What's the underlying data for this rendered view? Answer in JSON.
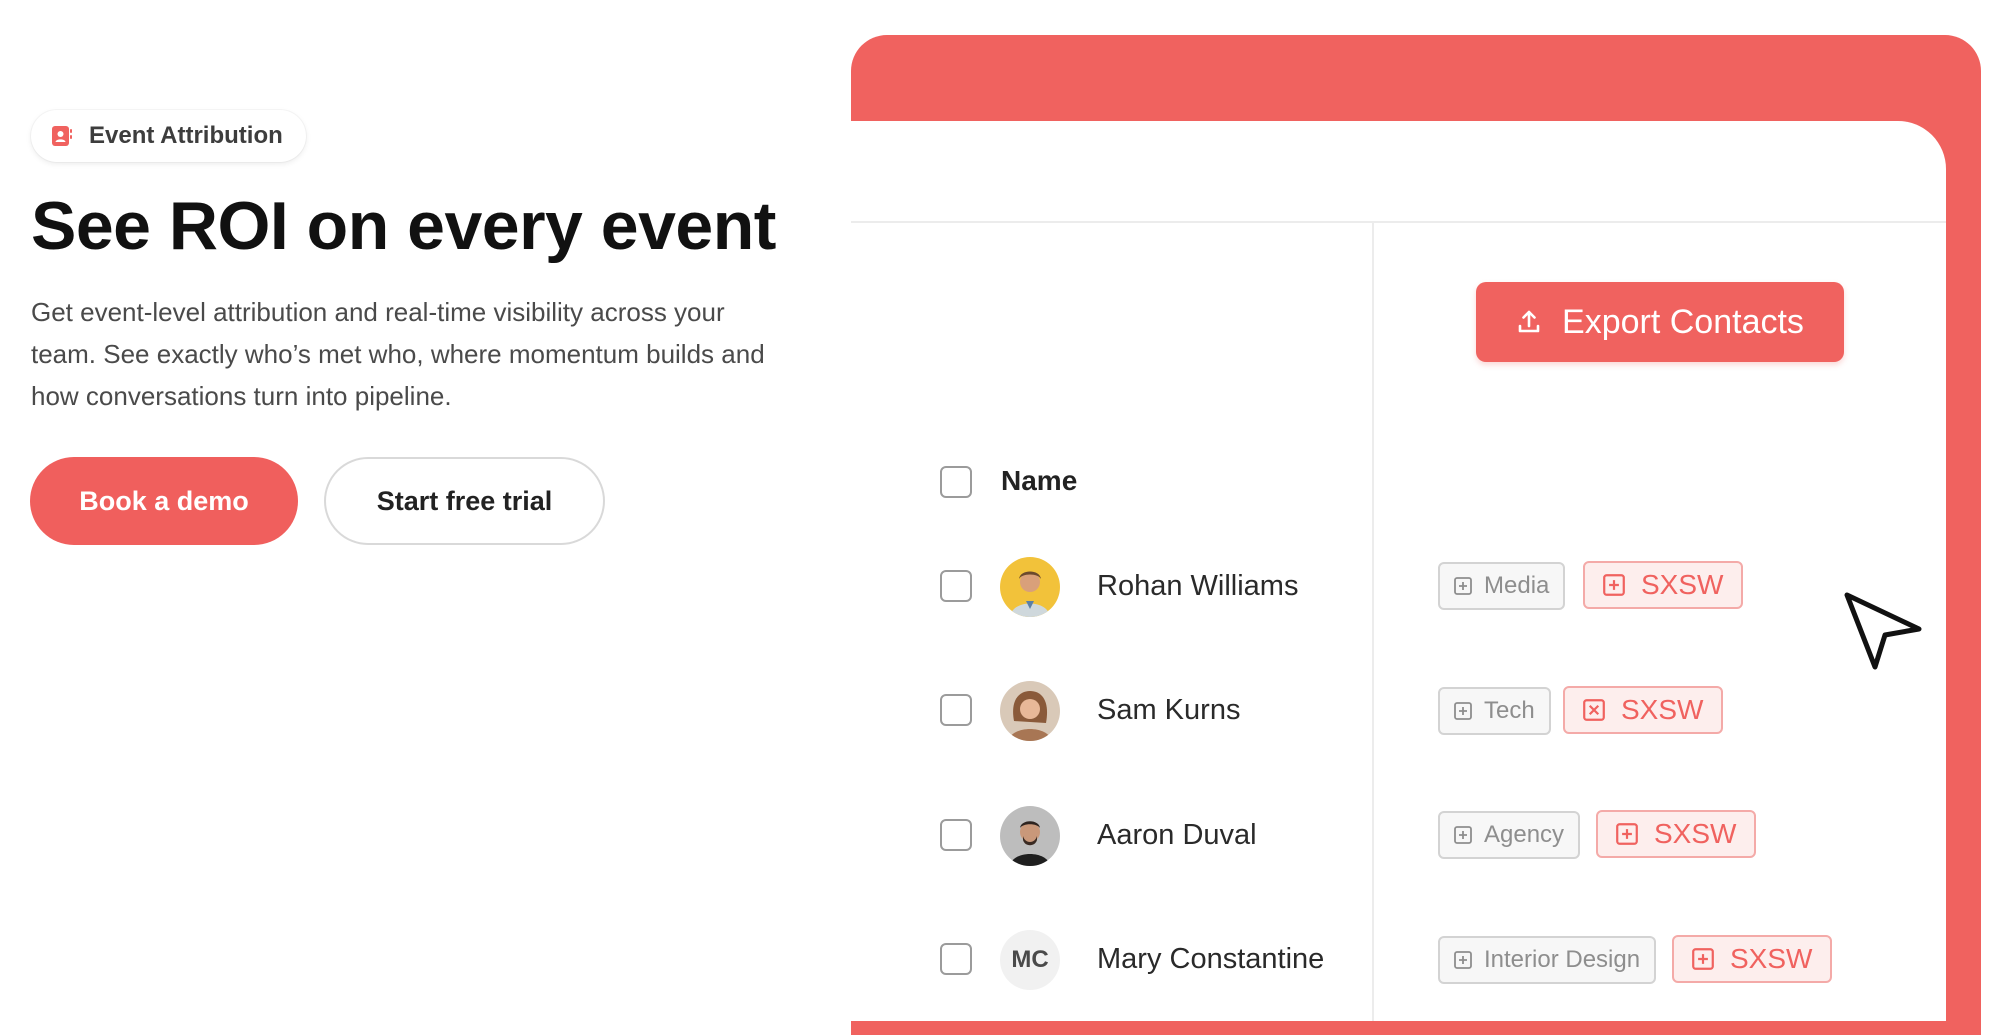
{
  "hero": {
    "badge_label": "Event Attribution",
    "badge_icon": "contact-card-icon",
    "headline": "See ROI on every event",
    "subtext": "Get event-level attribution and real-time visibility across your team. See exactly who’s met who, where momentum builds and how conversations turn into pipeline.",
    "primary_button": "Book a demo",
    "secondary_button": "Start free trial"
  },
  "colors": {
    "brand": "#f0625f",
    "tag_red_bg": "#fdeeed",
    "tag_grey_bg": "#f7f7f7"
  },
  "mock": {
    "export_button": "Export Contacts",
    "export_icon": "upload-icon",
    "column_header": "Name",
    "cursor_icon": "arrow-cursor-icon",
    "contacts": [
      {
        "name": "Rohan Williams",
        "avatar": "photo",
        "tag": "Media",
        "event": "SXSW",
        "event_icon": "plus-box-icon"
      },
      {
        "name": "Sam Kurns",
        "avatar": "photo",
        "tag": "Tech",
        "event": "SXSW",
        "event_icon": "x-box-icon"
      },
      {
        "name": "Aaron Duval",
        "avatar": "photo",
        "tag": "Agency",
        "event": "SXSW",
        "event_icon": "plus-box-icon"
      },
      {
        "name": "Mary Constantine",
        "avatar": "initials",
        "initials": "MC",
        "tag": "Interior Design",
        "event": "SXSW",
        "event_icon": "plus-box-icon"
      }
    ]
  }
}
